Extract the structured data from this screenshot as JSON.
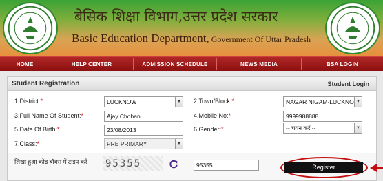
{
  "header": {
    "title_hindi": "बेसिक शिक्षा विभाग,उत्तर प्रदेश सरकार",
    "title_en_main": "Basic Education Department,",
    "title_en_small": " Government Of Uttar Pradesh",
    "emblem_text": "उत्तर प्रदेश सरकार"
  },
  "nav": {
    "items": [
      "HOME",
      "HELP CENTER",
      "ADMISSION SCHEDULE",
      "NEWS MEDIA",
      "BSA LOGIN"
    ]
  },
  "panel": {
    "title": "Student Registration",
    "login_link": "Student Login"
  },
  "form": {
    "district": {
      "label": "1.District:",
      "value": "LUCKNOW"
    },
    "town": {
      "label": "2.Town/Block:",
      "value": "NAGAR NIGAM-LUCKNOW"
    },
    "student_name": {
      "label": "3.Full Name Of Student:",
      "value": "Ajay Chohan"
    },
    "mobile": {
      "label": "4.Mobile No:",
      "value": "9999988888"
    },
    "dob": {
      "label": "5.Date Of Birth:",
      "value": "23/08/2013"
    },
    "gender": {
      "label": "6.Gender:",
      "value": "-- चयन करें --"
    },
    "class": {
      "label": "7.Class:",
      "value": "PRE PRIMARY"
    },
    "required_mark": "*"
  },
  "captcha": {
    "label": "लिखा हुआ कोड बॉक्स में टाइप करें",
    "image_text": "95355",
    "input_value": "95355"
  },
  "register_label": "Register",
  "colors": {
    "nav_red": "#9c1a1a",
    "header_green": "#3aa336",
    "header_orange": "#e88f3c",
    "highlight_red": "#c21010"
  }
}
